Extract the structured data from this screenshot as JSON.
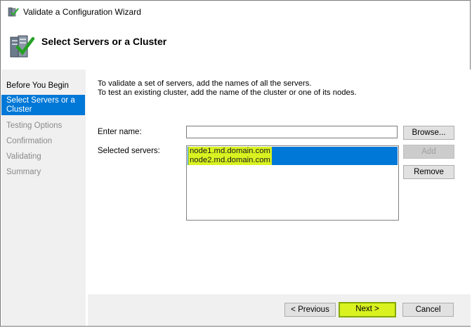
{
  "window": {
    "title": "Validate a Configuration Wizard"
  },
  "header": {
    "title": "Select Servers or a Cluster",
    "icon": "validate-wizard-icon"
  },
  "nav": {
    "items": [
      {
        "label": "Before You Begin",
        "state": "normal"
      },
      {
        "label": "Select Servers or a Cluster",
        "state": "selected"
      },
      {
        "label": "Testing Options",
        "state": "disabled"
      },
      {
        "label": "Confirmation",
        "state": "disabled"
      },
      {
        "label": "Validating",
        "state": "disabled"
      },
      {
        "label": "Summary",
        "state": "disabled"
      }
    ]
  },
  "main": {
    "description_line1": "To validate a set of servers, add the names of all the servers.",
    "description_line2": "To test an existing cluster, add the name of the cluster or one of its nodes.",
    "enter_name_label": "Enter name:",
    "enter_name_value": "",
    "selected_servers_label": "Selected servers:",
    "selected_servers": [
      "node1.md.domain.com",
      "node2.md.domain.com"
    ],
    "browse_label": "Browse...",
    "add_label": "Add",
    "remove_label": "Remove"
  },
  "footer": {
    "previous_label": "< Previous",
    "next_label": "Next >",
    "cancel_label": "Cancel"
  },
  "colors": {
    "selection_blue": "#0078d7",
    "highlight_yellow": "#d9f220"
  }
}
